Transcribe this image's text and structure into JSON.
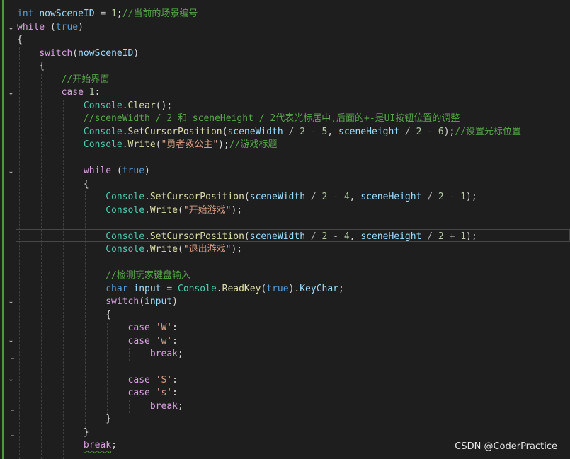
{
  "tokens": {
    "int": "int",
    "char": "char",
    "true": "true",
    "while": "while",
    "switch": "switch",
    "case": "case",
    "break": "break",
    "nowSceneID": "nowSceneID",
    "Console": "Console",
    "Clear": "Clear",
    "SetCursorPosition": "SetCursorPosition",
    "Write": "Write",
    "ReadKey": "ReadKey",
    "KeyChar": "KeyChar",
    "sceneWidth": "sceneWidth",
    "sceneHeight": "sceneHeight",
    "input": "input",
    "n1": "1",
    "n2": "2",
    "n4": "4",
    "n5": "5",
    "n6": "6",
    "chW": "'W'",
    "chw": "'w'",
    "chS": "'S'",
    "chs": "'s'"
  },
  "code": {
    "comment_scene_id": "//当前的场景编号",
    "comment_start_ui": "//开始界面",
    "comment_center_cursor": "//sceneWidth / 2 和 sceneHeight / 2代表光标居中,后面的+-是UI按钮位置的调整",
    "comment_set_cursor": "//设置光标位置",
    "comment_game_title": "//游戏标题",
    "comment_keyboard_input": "//检测玩家键盘输入",
    "str_title": "\"勇者救公主\"",
    "str_start": "\"开始游戏\"",
    "str_exit": "\"退出游戏\""
  },
  "watermark": "CSDN @CoderPractice"
}
